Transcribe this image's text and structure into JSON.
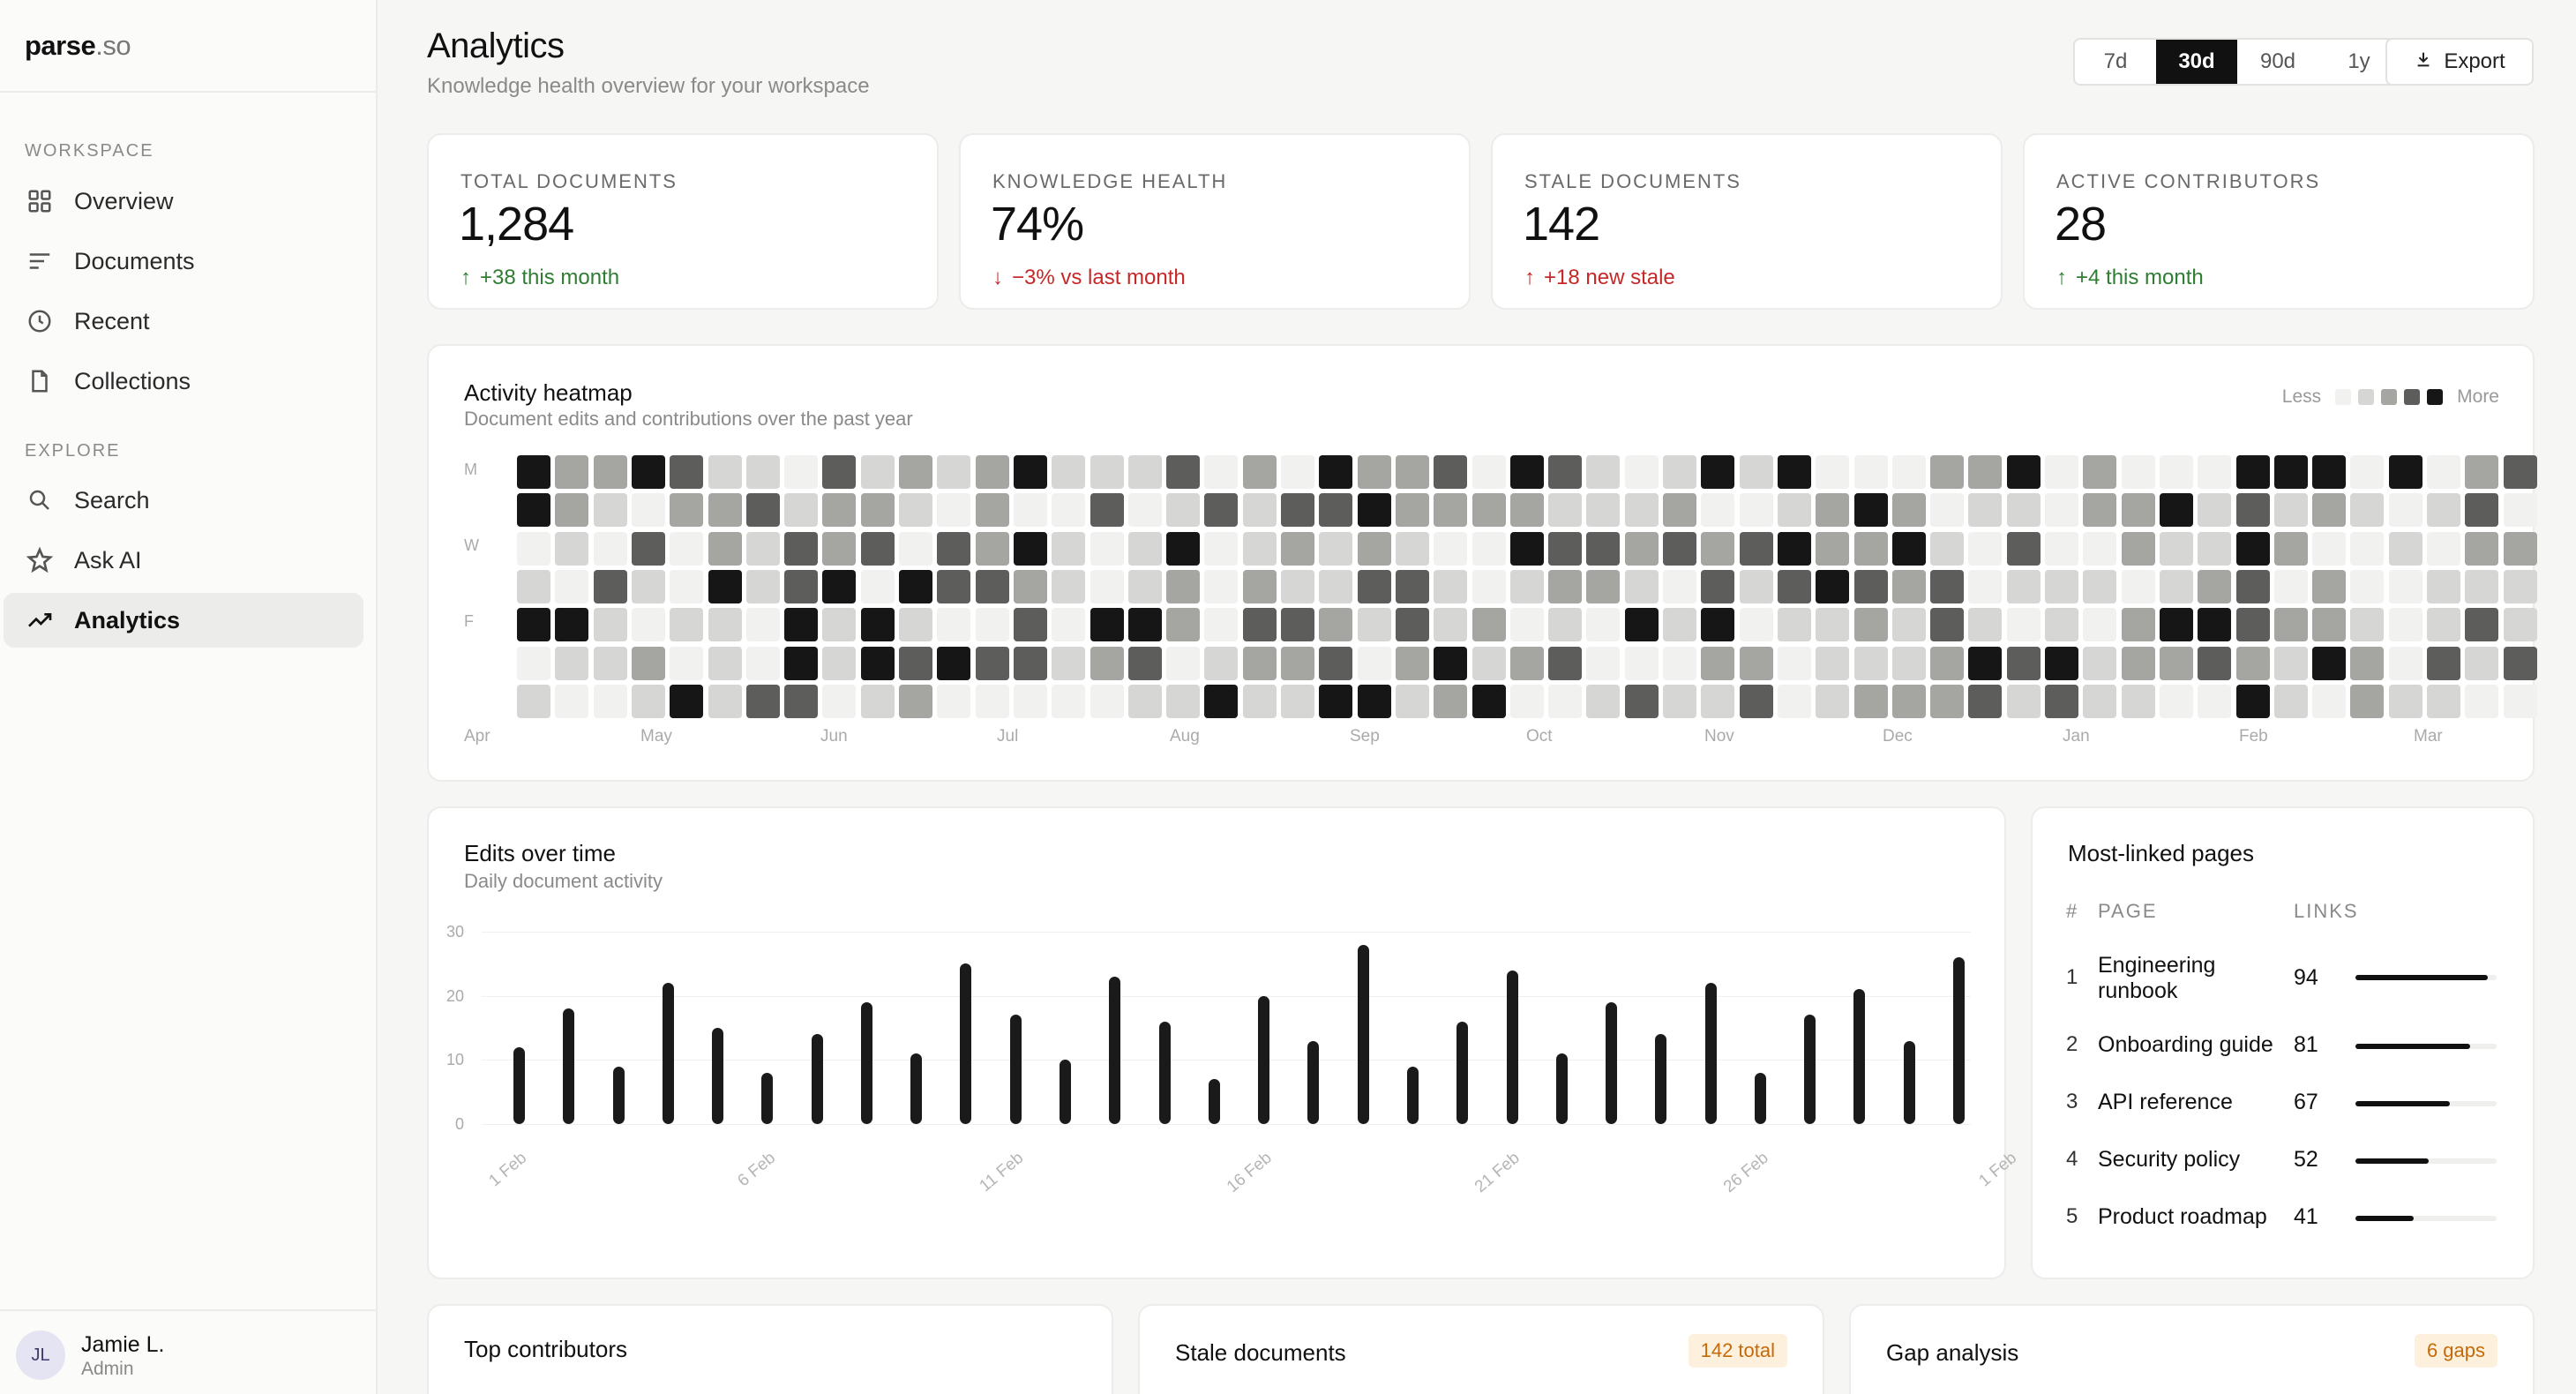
{
  "brand": {
    "name": "parse",
    "tld": ".so"
  },
  "sidebar": {
    "workspace_label": "WORKSPACE",
    "explore_label": "EXPLORE",
    "items": [
      {
        "label": "Overview",
        "icon": "grid-icon"
      },
      {
        "label": "Documents",
        "icon": "lines-icon"
      },
      {
        "label": "Recent",
        "icon": "clock-icon"
      },
      {
        "label": "Collections",
        "icon": "file-icon"
      },
      {
        "label": "Search",
        "icon": "search-icon"
      },
      {
        "label": "Ask AI",
        "icon": "star-icon"
      },
      {
        "label": "Analytics",
        "icon": "trend-icon",
        "active": true
      }
    ],
    "user": {
      "initials": "JL",
      "name": "Jamie L.",
      "role": "Admin"
    }
  },
  "header": {
    "title": "Analytics",
    "subtitle": "Knowledge health overview for your workspace",
    "ranges": [
      "7d",
      "30d",
      "90d",
      "1y"
    ],
    "selected_range": "30d",
    "export_label": "Export"
  },
  "stats": [
    {
      "label": "TOTAL DOCUMENTS",
      "value": "1,284",
      "delta": "+38 this month",
      "direction": "up",
      "tone": "good"
    },
    {
      "label": "KNOWLEDGE HEALTH",
      "value": "74%",
      "delta": "−3% vs last month",
      "direction": "down",
      "tone": "bad"
    },
    {
      "label": "STALE DOCUMENTS",
      "value": "142",
      "delta": "+18 new stale",
      "direction": "up",
      "tone": "bad"
    },
    {
      "label": "ACTIVE CONTRIBUTORS",
      "value": "28",
      "delta": "+4 this month",
      "direction": "up",
      "tone": "good"
    }
  ],
  "heatmap": {
    "title": "Activity heatmap",
    "subtitle": "Document edits and contributions over the past year",
    "legend_less": "Less",
    "legend_more": "More",
    "levels": [
      "#f1f1f0",
      "#d6d6d4",
      "#a5a5a2",
      "#5d5d5b",
      "#161616"
    ],
    "day_labels": [
      "M",
      "W",
      "F"
    ],
    "months": [
      "Apr",
      "May",
      "Jun",
      "Jul",
      "Aug",
      "Sep",
      "Oct",
      "Nov",
      "Dec",
      "Jan",
      "Feb",
      "Mar"
    ]
  },
  "chart_data": {
    "type": "bar",
    "title": "Edits over time",
    "subtitle": "Daily document activity",
    "ylim": [
      0,
      30
    ],
    "yticks": [
      0,
      10,
      20,
      30
    ],
    "categories": [
      "1 Feb",
      "2 Feb",
      "3 Feb",
      "4 Feb",
      "5 Feb",
      "6 Feb",
      "7 Feb",
      "8 Feb",
      "9 Feb",
      "10 Feb",
      "11 Feb",
      "12 Feb",
      "13 Feb",
      "14 Feb",
      "15 Feb",
      "16 Feb",
      "17 Feb",
      "18 Feb",
      "19 Feb",
      "20 Feb",
      "21 Feb",
      "22 Feb",
      "23 Feb",
      "24 Feb",
      "25 Feb",
      "26 Feb",
      "27 Feb",
      "28 Feb",
      "29 Feb",
      "1 Mar"
    ],
    "tick_labels": [
      "1 Feb",
      "6 Feb",
      "11 Feb",
      "16 Feb",
      "21 Feb",
      "26 Feb",
      "1 Feb"
    ],
    "values": [
      12,
      18,
      9,
      22,
      15,
      8,
      14,
      19,
      11,
      25,
      17,
      10,
      23,
      16,
      7,
      20,
      13,
      28,
      9,
      16,
      24,
      11,
      19,
      14,
      22,
      8,
      17,
      21,
      13,
      26
    ]
  },
  "most_linked": {
    "title": "Most-linked pages",
    "col_rank": "#",
    "col_page": "PAGE",
    "col_links": "LINKS",
    "rows": [
      {
        "rank": "1",
        "page": "Engineering runbook",
        "links": 94
      },
      {
        "rank": "2",
        "page": "Onboarding guide",
        "links": 81
      },
      {
        "rank": "3",
        "page": "API reference",
        "links": 67
      },
      {
        "rank": "4",
        "page": "Security policy",
        "links": 52
      },
      {
        "rank": "5",
        "page": "Product roadmap",
        "links": 41
      }
    ]
  },
  "bottom_cards": {
    "contributors_title": "Top contributors",
    "stale_title": "Stale documents",
    "stale_badge": "142 total",
    "gap_title": "Gap analysis",
    "gap_badge": "6 gaps"
  },
  "colors": {
    "accent": "#111111",
    "good": "#2e7d32",
    "bad": "#c62828",
    "badge_bg": "#fdf0dc",
    "badge_text": "#c46a0a"
  }
}
